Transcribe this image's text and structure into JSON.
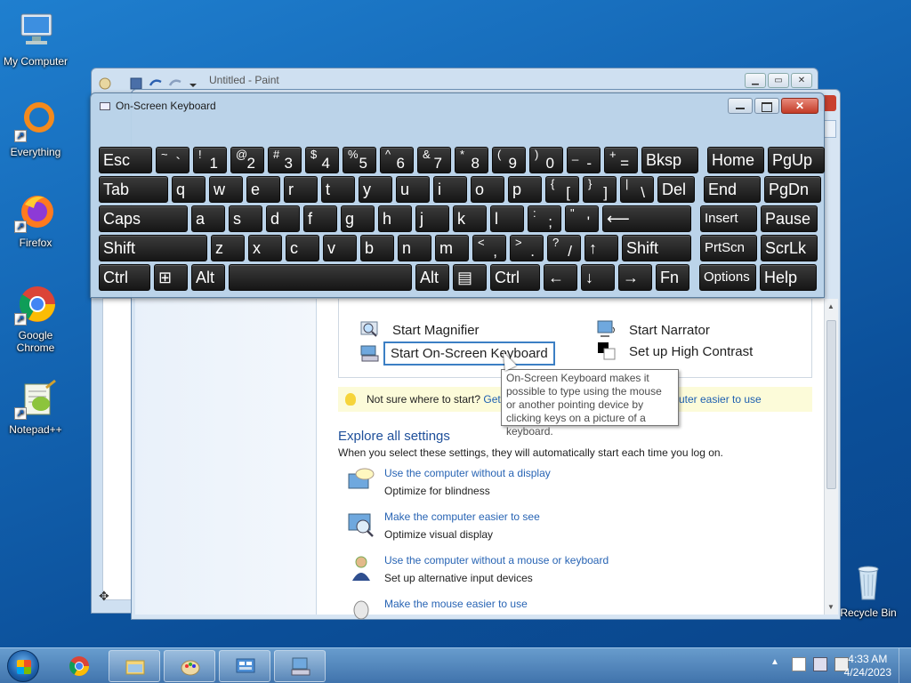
{
  "desktop": {
    "icons": [
      {
        "label": "My Computer",
        "icon": "computer-icon"
      },
      {
        "label": "Everything",
        "icon": "everything-icon"
      },
      {
        "label": "Firefox",
        "icon": "firefox-icon"
      },
      {
        "label": "Google Chrome",
        "icon": "chrome-icon"
      },
      {
        "label": "Notepad++",
        "icon": "notepadpp-icon"
      },
      {
        "label": "Recycle Bin",
        "icon": "recycle-bin-icon"
      }
    ]
  },
  "paint": {
    "title": "Untitled - Paint"
  },
  "osk": {
    "title": "On-Screen Keyboard",
    "rows": [
      [
        {
          "main": "Esc"
        },
        {
          "up": "~",
          "dn": "`"
        },
        {
          "up": "!",
          "dn": "1"
        },
        {
          "up": "@",
          "dn": "2"
        },
        {
          "up": "#",
          "dn": "3"
        },
        {
          "up": "$",
          "dn": "4"
        },
        {
          "up": "%",
          "dn": "5"
        },
        {
          "up": "^",
          "dn": "6"
        },
        {
          "up": "&",
          "dn": "7"
        },
        {
          "up": "*",
          "dn": "8"
        },
        {
          "up": "(",
          "dn": "9"
        },
        {
          "up": ")",
          "dn": "0"
        },
        {
          "up": "_",
          "dn": "-"
        },
        {
          "up": "+",
          "dn": "="
        },
        {
          "main": "Bksp"
        },
        {
          "main": "Home"
        },
        {
          "main": "PgUp"
        }
      ],
      [
        {
          "main": "Tab"
        },
        {
          "main": "q"
        },
        {
          "main": "w"
        },
        {
          "main": "e"
        },
        {
          "main": "r"
        },
        {
          "main": "t"
        },
        {
          "main": "y"
        },
        {
          "main": "u"
        },
        {
          "main": "i"
        },
        {
          "main": "o"
        },
        {
          "main": "p"
        },
        {
          "up": "{",
          "dn": "["
        },
        {
          "up": "}",
          "dn": "]"
        },
        {
          "up": "|",
          "dn": "\\"
        },
        {
          "main": "Del"
        },
        {
          "main": "End"
        },
        {
          "main": "PgDn"
        }
      ],
      [
        {
          "main": "Caps"
        },
        {
          "main": "a"
        },
        {
          "main": "s"
        },
        {
          "main": "d"
        },
        {
          "main": "f"
        },
        {
          "main": "g"
        },
        {
          "main": "h"
        },
        {
          "main": "j"
        },
        {
          "main": "k"
        },
        {
          "main": "l"
        },
        {
          "up": ":",
          "dn": ";"
        },
        {
          "up": "\"",
          "dn": "'"
        },
        {
          "main": "⟵"
        },
        {
          "main": "Insert"
        },
        {
          "main": "Pause"
        }
      ],
      [
        {
          "main": "Shift"
        },
        {
          "main": "z"
        },
        {
          "main": "x"
        },
        {
          "main": "c"
        },
        {
          "main": "v"
        },
        {
          "main": "b"
        },
        {
          "main": "n"
        },
        {
          "main": "m"
        },
        {
          "up": "<",
          "dn": ","
        },
        {
          "up": ">",
          "dn": "."
        },
        {
          "up": "?",
          "dn": "/"
        },
        {
          "main": "↑"
        },
        {
          "main": "Shift"
        },
        {
          "main": "PrtScn"
        },
        {
          "main": "ScrLk"
        }
      ],
      [
        {
          "main": "Ctrl"
        },
        {
          "main": "⊞"
        },
        {
          "main": "Alt"
        },
        {
          "main": ""
        },
        {
          "main": "Alt"
        },
        {
          "main": "▤"
        },
        {
          "main": "Ctrl"
        },
        {
          "main": "←"
        },
        {
          "main": "↓"
        },
        {
          "main": "→"
        },
        {
          "main": "Fn"
        },
        {
          "main": "Options"
        },
        {
          "main": "Help"
        }
      ]
    ]
  },
  "ease": {
    "tools": {
      "magnifier": "Start Magnifier",
      "narrator": "Start Narrator",
      "osk": "Start On-Screen Keyboard",
      "contrast": "Set up High Contrast"
    },
    "tip": {
      "text": "Not sure where to start?",
      "link1": "Get",
      "link2": "uter easier to use"
    },
    "explore_title": "Explore all settings",
    "explore_sub": "When you select these settings, they will automatically start each time you log on.",
    "settings": [
      {
        "link": "Use the computer without a display",
        "desc": "Optimize for blindness"
      },
      {
        "link": "Make the computer easier to see",
        "desc": "Optimize visual display"
      },
      {
        "link": "Use the computer without a mouse or keyboard",
        "desc": "Set up alternative input devices"
      },
      {
        "link": "Make the mouse easier to use",
        "desc": ""
      }
    ],
    "tooltip": "On-Screen Keyboard makes it possible to type using the mouse or another pointing device by clicking keys on a picture of a keyboard."
  },
  "taskbar": {
    "time": "4:33 AM",
    "date": "4/24/2023"
  }
}
